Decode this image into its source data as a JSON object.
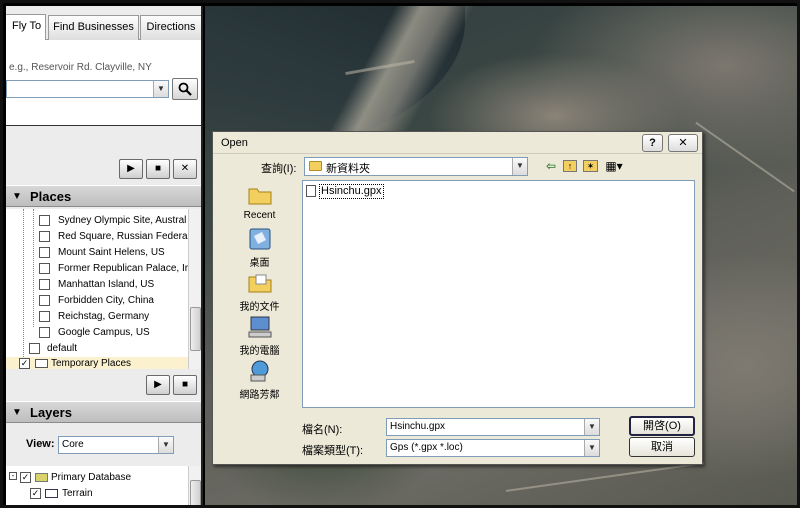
{
  "tabs": {
    "fly_to": "Fly To",
    "find_businesses": "Find Businesses",
    "directions": "Directions"
  },
  "fly_to": {
    "hint": "e.g., Reservoir Rd. Clayville, NY",
    "value": ""
  },
  "icons": {
    "search": "search-icon",
    "play": "play-icon",
    "stop": "stop-icon",
    "close": "close-icon",
    "collapse": "collapse-triangle-icon"
  },
  "places": {
    "title": "Places",
    "items": [
      {
        "label": "Sydney Olympic Site, Austral",
        "checked": false
      },
      {
        "label": "Red Square, Russian Federa",
        "checked": false
      },
      {
        "label": "Mount Saint Helens, US",
        "checked": false
      },
      {
        "label": "Former Republican Palace, Ir",
        "checked": false
      },
      {
        "label": "Manhattan Island, US",
        "checked": false
      },
      {
        "label": "Forbidden City, China",
        "checked": false
      },
      {
        "label": "Reichstag, Germany",
        "checked": false
      },
      {
        "label": "Google Campus, US",
        "checked": false
      }
    ],
    "default_label": "default",
    "temporary_label": "Temporary Places"
  },
  "layers": {
    "title": "Layers",
    "view_label": "View:",
    "view_value": "Core",
    "items": [
      {
        "label": "Primary Database"
      },
      {
        "label": "Terrain"
      }
    ]
  },
  "dialog": {
    "title": "Open",
    "help": "?",
    "close": "✕",
    "look_in_label": "查詢(I):",
    "look_in_value": "新資料夾",
    "places": [
      {
        "label": "Recent",
        "icon": "recent-folder-icon"
      },
      {
        "label": "桌面",
        "icon": "desktop-icon"
      },
      {
        "label": "我的文件",
        "icon": "my-documents-icon"
      },
      {
        "label": "我的電腦",
        "icon": "my-computer-icon"
      },
      {
        "label": "網路芳鄰",
        "icon": "network-icon"
      }
    ],
    "files": [
      {
        "name": "Hsinchu.gpx"
      }
    ],
    "file_name_label": "檔名(N):",
    "file_name_value": "Hsinchu.gpx",
    "file_type_label": "檔案類型(T):",
    "file_type_value": "Gps (*.gpx *.loc)",
    "open_button": "開啓(O)",
    "cancel_button": "取消"
  }
}
